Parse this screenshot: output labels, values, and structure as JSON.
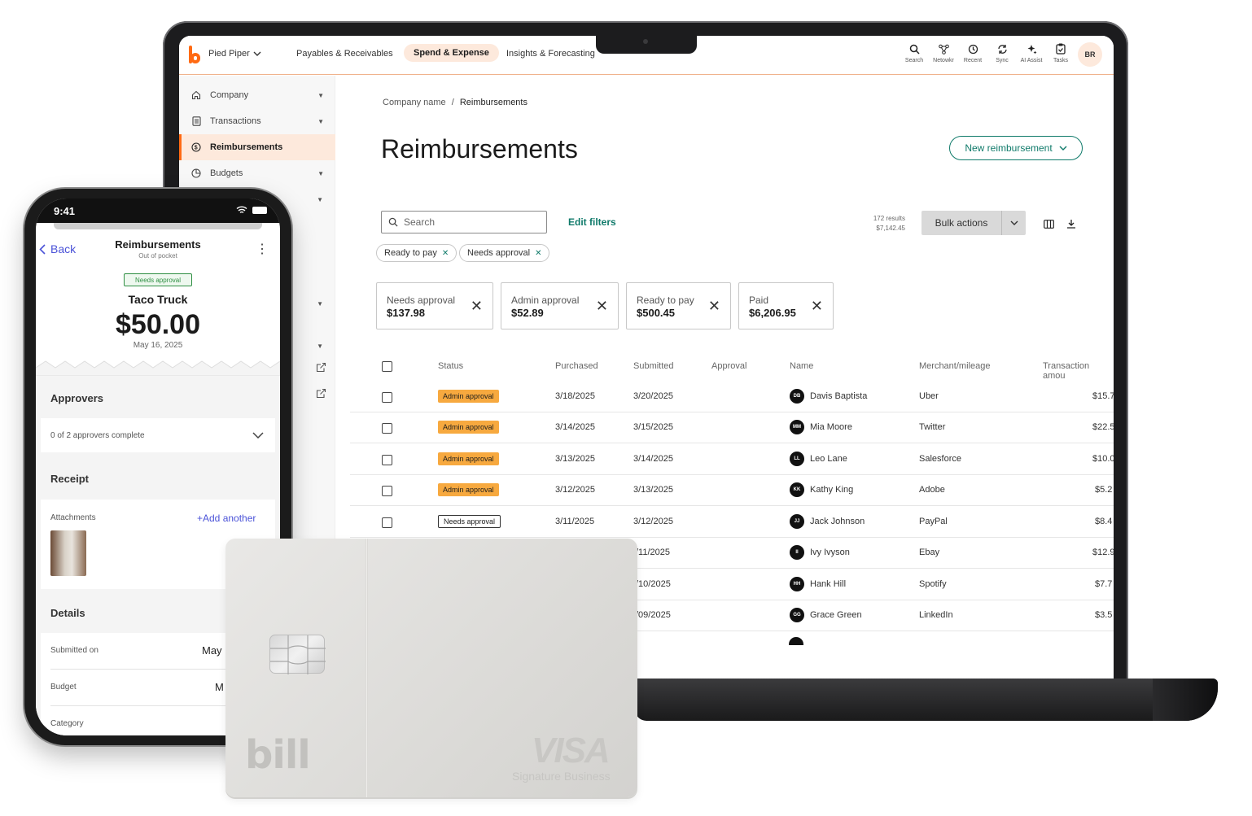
{
  "topnav": {
    "company": "Pied Piper",
    "links": [
      "Payables & Receivables",
      "Spend & Expense",
      "Insights & Forecasting"
    ],
    "tools": [
      "Search",
      "Netowkr",
      "Recent",
      "Sync",
      "AI Assist",
      "Tasks"
    ],
    "avatar": "BR"
  },
  "sidebar": {
    "items": [
      {
        "label": "Company",
        "icon": "home-icon"
      },
      {
        "label": "Transactions",
        "icon": "document-icon"
      },
      {
        "label": "Reimbursements",
        "icon": "reimburse-icon"
      },
      {
        "label": "Budgets",
        "icon": "pie-icon"
      }
    ]
  },
  "main": {
    "breadcrumb_root": "Company name",
    "breadcrumb_sep": "/",
    "breadcrumb_current": "Reimbursements",
    "title": "Reimbursements",
    "new_button": "New reimbursement",
    "search_placeholder": "Search",
    "edit_filters": "Edit filters",
    "results_count": "172 results",
    "results_total": "$7,142.45",
    "bulk_actions": "Bulk actions",
    "chips": [
      "Ready to pay",
      "Needs approval"
    ],
    "summary": [
      {
        "label": "Needs approval",
        "value": "$137.98"
      },
      {
        "label": "Admin approval",
        "value": "$52.89"
      },
      {
        "label": "Ready to pay",
        "value": "$500.45"
      },
      {
        "label": "Paid",
        "value": "$6,206.95"
      }
    ],
    "columns": [
      "Status",
      "Purchased",
      "Submitted",
      "Approval",
      "Name",
      "Merchant/mileage",
      "Transaction amou"
    ],
    "rows": [
      {
        "status": "Admin approval",
        "purchased": "3/18/2025",
        "submitted": "3/20/2025",
        "initials": "DB",
        "name": "Davis Baptista",
        "merchant": "Uber",
        "amount": "$15.7"
      },
      {
        "status": "Admin approval",
        "purchased": "3/14/2025",
        "submitted": "3/15/2025",
        "initials": "MM",
        "name": "Mia Moore",
        "merchant": "Twitter",
        "amount": "$22.5"
      },
      {
        "status": "Admin approval",
        "purchased": "3/13/2025",
        "submitted": "3/14/2025",
        "initials": "LL",
        "name": "Leo Lane",
        "merchant": "Salesforce",
        "amount": "$10.0"
      },
      {
        "status": "Admin approval",
        "purchased": "3/12/2025",
        "submitted": "3/13/2025",
        "initials": "KK",
        "name": "Kathy King",
        "merchant": "Adobe",
        "amount": "$5.2"
      },
      {
        "status": "Needs approval",
        "purchased": "3/11/2025",
        "submitted": "3/12/2025",
        "initials": "JJ",
        "name": "Jack Johnson",
        "merchant": "PayPal",
        "amount": "$8.4"
      },
      {
        "status": "",
        "purchased": "",
        "submitted": "/11/2025",
        "initials": "II",
        "name": "Ivy Ivyson",
        "merchant": "Ebay",
        "amount": "$12.9"
      },
      {
        "status": "",
        "purchased": "",
        "submitted": "/10/2025",
        "initials": "HH",
        "name": "Hank Hill",
        "merchant": "Spotify",
        "amount": "$7.7"
      },
      {
        "status": "",
        "purchased": "",
        "submitted": "/09/2025",
        "initials": "GG",
        "name": "Grace Green",
        "merchant": "LinkedIn",
        "amount": "$3.5"
      }
    ]
  },
  "phone": {
    "time": "9:41",
    "back": "Back",
    "title": "Reimbursements",
    "subtitle": "Out of pocket",
    "badge": "Needs approval",
    "merchant": "Taco Truck",
    "amount": "$50.00",
    "date": "May 16, 2025",
    "approvers_heading": "Approvers",
    "approvers_status": "0 of 2 approvers complete",
    "receipt_heading": "Receipt",
    "attachments_label": "Attachments",
    "add_another": "+Add another",
    "details_heading": "Details",
    "submitted_label": "Submitted on",
    "submitted_value": "May",
    "budget_label": "Budget",
    "budget_value": "M",
    "category_label": "Category"
  },
  "card": {
    "brand": "bill",
    "network": "VISA",
    "tier": "Signature Business"
  },
  "colors": {
    "brand_orange": "#ff6a13",
    "accent_teal": "#0f7a6a",
    "admin_badge": "#f7a93f",
    "phone_link": "#4b53d8"
  }
}
